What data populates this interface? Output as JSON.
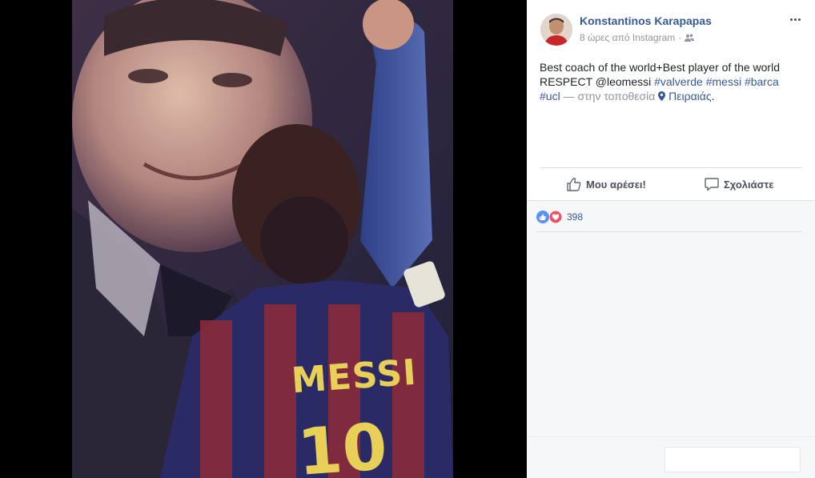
{
  "post": {
    "author": "Konstantinos Karapapas",
    "time": "8 ώρες από Instagram",
    "text": {
      "line1": "Best coach of the world+Best player of the world",
      "respect": "RESPECT @leomessi ",
      "hashtags": [
        "#valverde",
        "#messi",
        "#barca",
        "#ucl"
      ],
      "location_prefix": " — στην τοποθεσία ",
      "location": "Πειραιάς",
      "end": "."
    }
  },
  "actions": {
    "like": "Μου αρέσει!",
    "comment": "Σχολιάστε"
  },
  "reactions": {
    "count": "398",
    "types": [
      "like-icon",
      "love-icon"
    ]
  },
  "photo": {
    "jersey_name": "MESSI",
    "jersey_number": "10"
  },
  "colors": {
    "link": "#365899",
    "like_blue": "#5890ff",
    "love_red": "#f25268",
    "panel_bg": "#ffffff",
    "lower_bg": "#f6f7f9"
  }
}
